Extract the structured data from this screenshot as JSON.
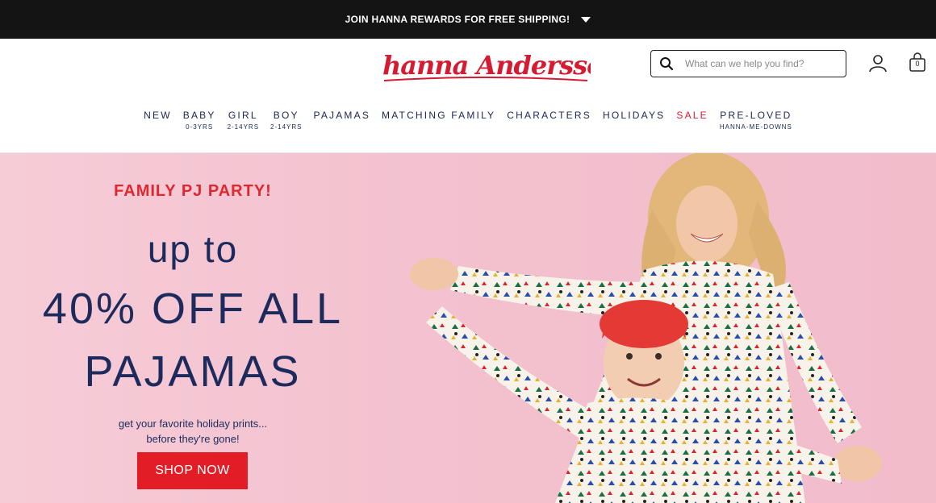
{
  "promo": {
    "text": "JOIN HANNA REWARDS FOR FREE SHIPPING!",
    "icon": "chevron-down-icon"
  },
  "header": {
    "logo_text": "hanna Andersson",
    "search_placeholder": "What can we help you find?",
    "cart_count": "0"
  },
  "nav": [
    {
      "label": "NEW",
      "sub": ""
    },
    {
      "label": "BABY",
      "sub": "0-3YRS"
    },
    {
      "label": "GIRL",
      "sub": "2-14YRS"
    },
    {
      "label": "BOY",
      "sub": "2-14YRS"
    },
    {
      "label": "PAJAMAS",
      "sub": ""
    },
    {
      "label": "MATCHING FAMILY",
      "sub": ""
    },
    {
      "label": "CHARACTERS",
      "sub": ""
    },
    {
      "label": "HOLIDAYS",
      "sub": ""
    },
    {
      "label": "SALE",
      "sub": ""
    },
    {
      "label": "PRE-LOVED",
      "sub": "HANNA-ME-DOWNS"
    }
  ],
  "hero": {
    "eyebrow": "FAMILY PJ PARTY!",
    "line1": "up to",
    "line2": "40% OFF ALL",
    "line3": "PAJAMAS",
    "sub1": "get your favorite holiday prints...",
    "sub2": "before they're gone!",
    "cta": "SHOP NOW"
  },
  "colors": {
    "brand_red": "#d51b32",
    "navy": "#1d2a5c",
    "hero_pink": "#f3c1cf",
    "promo_bg": "#141414"
  }
}
